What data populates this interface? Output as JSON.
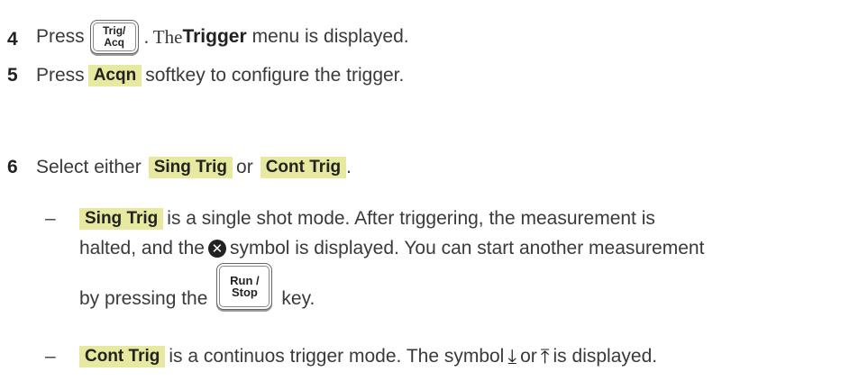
{
  "step4": {
    "number": "4",
    "press": "Press",
    "key_line1": "Trig/",
    "key_line2": "Acq",
    "text_a": ". The ",
    "menu": "Trigger",
    "text_b": "menu is displayed."
  },
  "step5": {
    "number": "5",
    "press": "Press",
    "softkey": "Acqn",
    "text": "softkey to configure the trigger."
  },
  "step6": {
    "number": "6",
    "text_a": "Select either",
    "softkey_a": "Sing Trig",
    "or": "or",
    "softkey_b": "Cont Trig",
    "period": "."
  },
  "bullet1": {
    "dash": "–",
    "softkey": "Sing Trig",
    "text_a": "is a single shot mode. After triggering, the measurement is",
    "text_b": "halted, and the",
    "icon": "x-circle-icon",
    "text_c": "symbol is displayed. You can start another measurement",
    "text_d": "by pressing the",
    "key_line1": "Run /",
    "key_line2": "Stop",
    "text_e": "key."
  },
  "bullet2": {
    "dash": "–",
    "softkey": "Cont Trig",
    "text_a": "is a continuos trigger mode. The symbol",
    "symbol_a": "⤓",
    "or": "or",
    "symbol_b": "⤒",
    "text_b": "is displayed."
  }
}
